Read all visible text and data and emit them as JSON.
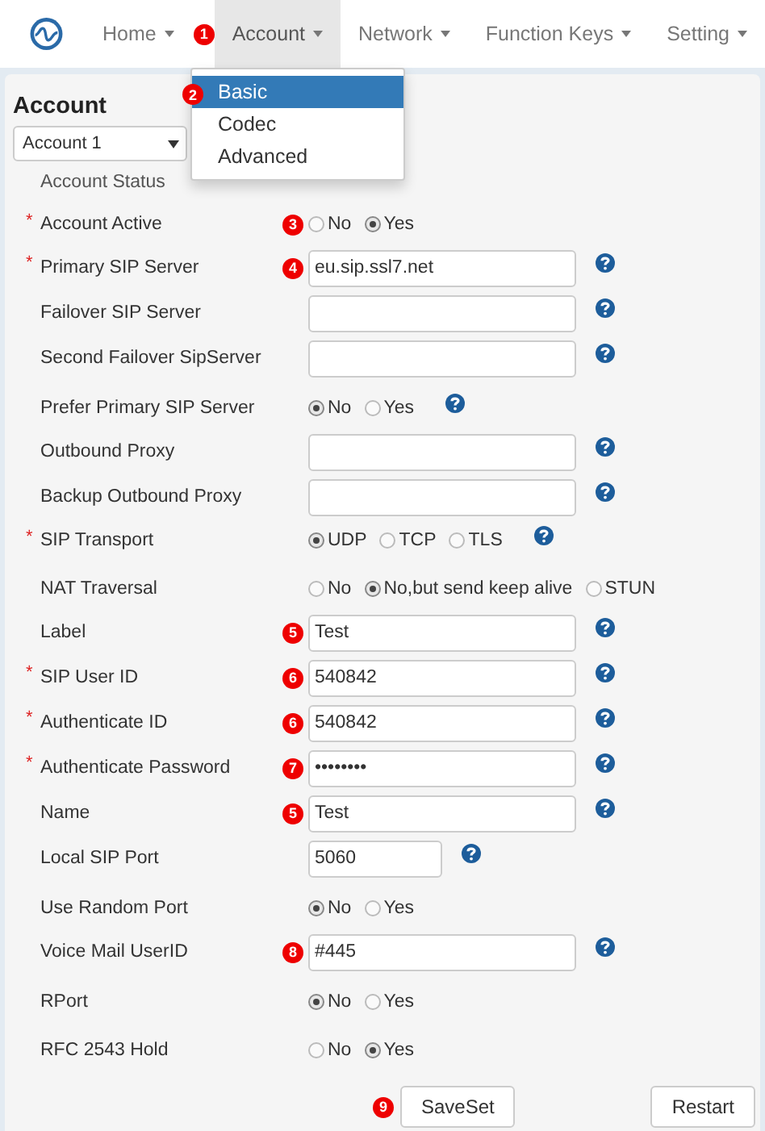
{
  "nav": [
    {
      "label": "Home",
      "selected": false
    },
    {
      "label": "Account",
      "selected": true,
      "badge": "1"
    },
    {
      "label": "Network",
      "selected": false
    },
    {
      "label": "Function Keys",
      "selected": false
    },
    {
      "label": "Setting",
      "selected": false
    }
  ],
  "menu": [
    {
      "label": "Basic",
      "selected": true,
      "badge": "2"
    },
    {
      "label": "Codec",
      "selected": false
    },
    {
      "label": "Advanced",
      "selected": false
    }
  ],
  "title": "Account",
  "account_select": {
    "value": "Account 1"
  },
  "fields": [
    {
      "kind": "status",
      "label": "Account Status",
      "help": false
    },
    {
      "kind": "radio",
      "label": "Account Active",
      "marker": "*",
      "badge": "3",
      "help": false,
      "options": [
        {
          "label": "No",
          "selected": false
        },
        {
          "label": "Yes",
          "selected": true
        }
      ]
    },
    {
      "kind": "text",
      "label": "Primary SIP Server",
      "marker": "*",
      "badge": "4",
      "value": "eu.sip.ssl7.net",
      "help": true
    },
    {
      "kind": "text",
      "label": "Failover SIP Server",
      "help": true
    },
    {
      "kind": "text",
      "label": "Second Failover SipServer",
      "help": true
    },
    {
      "kind": "radio",
      "label": "Prefer Primary SIP Server",
      "help": true,
      "options": [
        {
          "label": "No",
          "selected": true
        },
        {
          "label": "Yes",
          "selected": false
        }
      ]
    },
    {
      "kind": "text",
      "label": "Outbound Proxy",
      "help": true
    },
    {
      "kind": "text",
      "label": "Backup Outbound Proxy",
      "help": true
    },
    {
      "kind": "radio",
      "label": "SIP Transport",
      "marker": "*",
      "help": true,
      "options": [
        {
          "label": "UDP",
          "selected": true
        },
        {
          "label": "TCP",
          "selected": false
        },
        {
          "label": "TLS",
          "selected": false
        }
      ]
    },
    {
      "kind": "radio",
      "label": "NAT Traversal",
      "help": false,
      "options": [
        {
          "label": "No",
          "selected": false
        },
        {
          "label": "No,but send keep alive",
          "selected": true
        },
        {
          "label": "STUN",
          "selected": false
        }
      ]
    },
    {
      "kind": "text",
      "label": "Label",
      "badge": "5",
      "value": "Test",
      "help": true
    },
    {
      "kind": "text",
      "label": "SIP User ID",
      "marker": "*",
      "badge": "6",
      "value": "540842",
      "help": true
    },
    {
      "kind": "text",
      "label": "Authenticate ID",
      "marker": "*",
      "badge": "6",
      "value": "540842",
      "help": true
    },
    {
      "kind": "text",
      "label": "Authenticate Password",
      "marker": "*",
      "badge": "7",
      "value": "••••••••",
      "help": true
    },
    {
      "kind": "text",
      "label": "Name",
      "badge": "5",
      "value": "Test",
      "help": true
    },
    {
      "kind": "short",
      "label": "Local SIP Port",
      "value": "5060",
      "help": true
    },
    {
      "kind": "radio",
      "label": "Use Random Port",
      "help": false,
      "options": [
        {
          "label": "No",
          "selected": true
        },
        {
          "label": "Yes",
          "selected": false
        }
      ]
    },
    {
      "kind": "text",
      "label": "Voice Mail UserID",
      "badge": "8",
      "value": "#445",
      "help": true
    },
    {
      "kind": "radio",
      "label": "RPort",
      "help": false,
      "options": [
        {
          "label": "No",
          "selected": true
        },
        {
          "label": "Yes",
          "selected": false
        }
      ]
    },
    {
      "kind": "radio",
      "label": "RFC 2543 Hold",
      "help": false,
      "options": [
        {
          "label": "No",
          "selected": false
        },
        {
          "label": "Yes",
          "selected": true
        }
      ]
    }
  ],
  "buttons": [
    {
      "label": "SaveSet",
      "badge": "9"
    },
    {
      "label": "Restart"
    }
  ]
}
